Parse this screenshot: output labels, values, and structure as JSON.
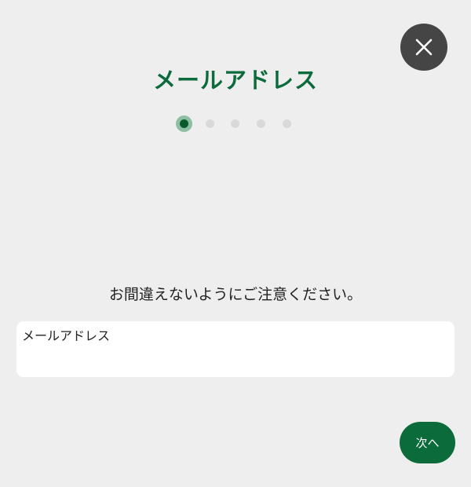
{
  "header": {
    "title": "メールアドレス",
    "close_icon": "close-icon"
  },
  "steps": {
    "total": 5,
    "current": 1
  },
  "form": {
    "instruction": "お間違えないようにご注意ください。",
    "email_placeholder": "メールアドレス",
    "email_value": ""
  },
  "footer": {
    "next_label": "次へ"
  },
  "colors": {
    "accent": "#0b6b3a",
    "close_bg": "#454545",
    "background": "#eeeeee"
  }
}
